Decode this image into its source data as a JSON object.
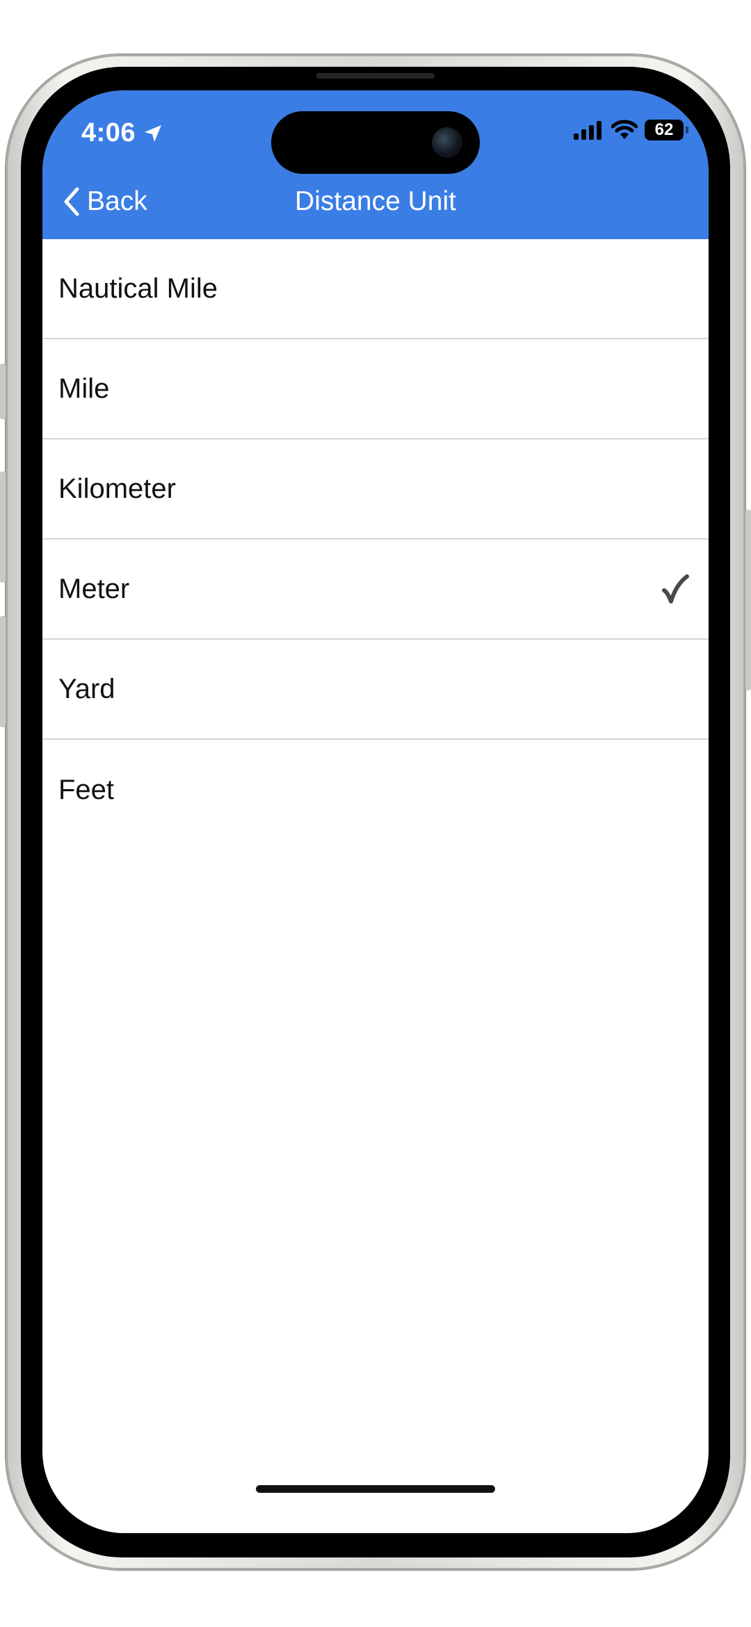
{
  "status_bar": {
    "time": "4:06",
    "battery": "62",
    "icons": [
      "location-arrow-icon",
      "cellular-signal-icon",
      "wifi-icon",
      "battery-icon"
    ]
  },
  "nav": {
    "back_label": "Back",
    "title": "Distance Unit"
  },
  "units": [
    {
      "label": "Nautical Mile",
      "selected": false
    },
    {
      "label": "Mile",
      "selected": false
    },
    {
      "label": "Kilometer",
      "selected": false
    },
    {
      "label": "Meter",
      "selected": true
    },
    {
      "label": "Yard",
      "selected": false
    },
    {
      "label": "Feet",
      "selected": false
    }
  ],
  "colors": {
    "nav_background": "#3a7de4",
    "checkmark": "#4a4a4a",
    "separator": "#d4d4d4"
  }
}
